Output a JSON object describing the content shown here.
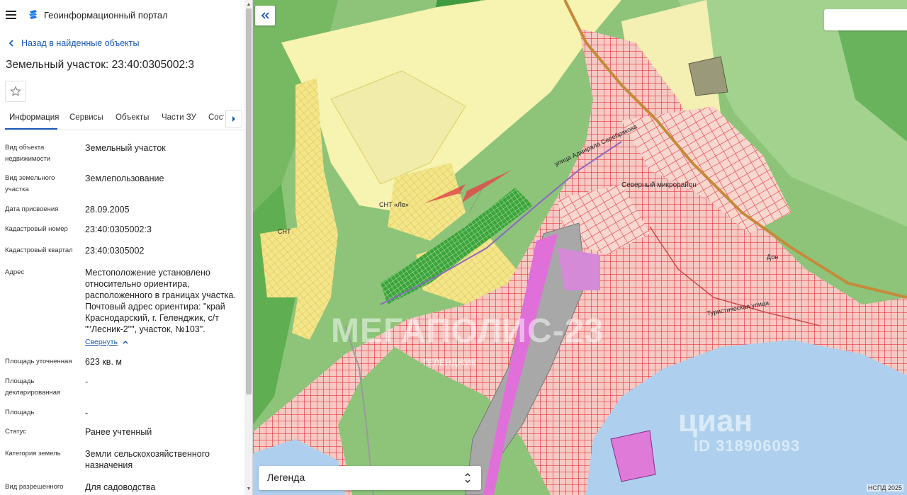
{
  "header": {
    "app_title": "Геоинформационный портал",
    "menu_icon": "menu-icon",
    "logo_icon": "portal-logo-icon"
  },
  "nav": {
    "back_label": "Назад в найденные объекты"
  },
  "object": {
    "title": "Земельный участок: 23:40:0305002:3"
  },
  "tabs": [
    {
      "label": "Информация",
      "active": true
    },
    {
      "label": "Сервисы"
    },
    {
      "label": "Объекты"
    },
    {
      "label": "Части ЗУ"
    },
    {
      "label": "Состав"
    }
  ],
  "info": [
    {
      "label": "Вид объекта недвижимости",
      "value": "Земельный участок"
    },
    {
      "label": "Вид земельного участка",
      "value": "Землепользование"
    },
    {
      "label": "Дата присвоения",
      "value": "28.09.2005"
    },
    {
      "label": "Кадастровый номер",
      "value": "23:40:0305002:3"
    },
    {
      "label": "Кадастровый квартал",
      "value": "23:40:0305002"
    },
    {
      "label": "Адрес",
      "value": "Местоположение установлено относительно ориентира, расположенного в границах участка. Почтовый адрес ориентира: \"край Краснодарский, г. Геленджик, с/т \"\"Лесник-2\"\", участок, №103\".",
      "link": "Свернуть"
    },
    {
      "label": "Площадь уточненная",
      "value": "623 кв. м"
    },
    {
      "label": "Площадь декларированная",
      "value": "-"
    },
    {
      "label": "Площадь",
      "value": "-"
    },
    {
      "label": "Статус",
      "value": "Ранее учтенный"
    },
    {
      "label": "Категория земель",
      "value": "Земли сельскохозяйственного назначения"
    },
    {
      "label": "Вид разрешенного",
      "value": "Для садоводства"
    }
  ],
  "map": {
    "legend_label": "Легенда",
    "attribution": "НСПД 2025",
    "labels": {
      "district": "Северный микрорайон",
      "snt1": "СНТ «Ле»",
      "snt2": "СНТ",
      "street1": "улица Адмирала Серебрякова",
      "street2": "Туристическая улица",
      "street3": "Дон"
    },
    "watermark_main": "МЕГАПОЛИС-23",
    "watermark_sub": "ГЕЛЕНДЖИК",
    "watermark_cian": "циан",
    "watermark_id": "ID 318906093"
  },
  "colors": {
    "accent": "#1a5ab8",
    "parcel_red": "#e8383f",
    "sea": "#aed0ee",
    "forest": "#82bd6a",
    "agri_yellow": "#f6f1a6",
    "pink_zone": "#e07ad8"
  }
}
